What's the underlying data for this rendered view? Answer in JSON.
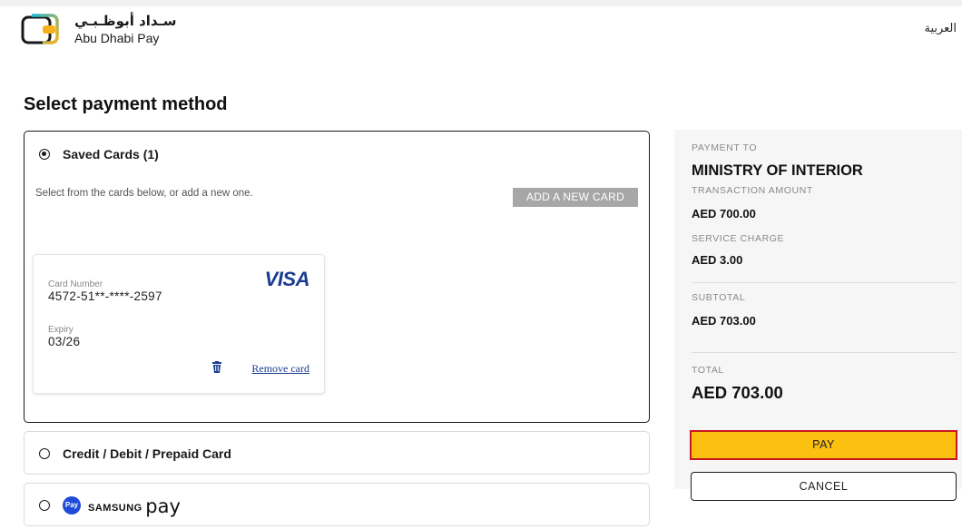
{
  "header": {
    "logo_ar": "سـداد أبوظـبـي",
    "logo_en": "Abu Dhabi Pay",
    "lang_link": "العربية"
  },
  "page_title": "Select payment method",
  "saved_cards": {
    "label": "Saved Cards (1)",
    "hint": "Select from the cards below, or add a new one.",
    "add_button": "ADD A NEW CARD",
    "card": {
      "brand": "VISA",
      "number_label": "Card Number",
      "number": "4572-51**-****-2597",
      "expiry_label": "Expiry",
      "expiry": "03/26",
      "remove_label": "Remove card"
    }
  },
  "methods": {
    "credit": "Credit / Debit / Prepaid Card",
    "samsung_badge": "Pay",
    "samsung_brand": "SAMSUNG",
    "samsung_pay": "pay"
  },
  "summary": {
    "payment_to_label": "PAYMENT TO",
    "payment_to": "MINISTRY OF INTERIOR",
    "transaction_label": "TRANSACTION AMOUNT",
    "transaction": "AED  700.00",
    "service_label": "SERVICE CHARGE",
    "service": "AED  3.00",
    "subtotal_label": "SUBTOTAL",
    "subtotal": "AED  703.00",
    "total_label": "TOTAL",
    "total": "AED 703.00"
  },
  "actions": {
    "pay": "PAY",
    "cancel": "CANCEL"
  },
  "colors": {
    "pay_bg": "#fcc010",
    "pay_border": "#c7171e",
    "link": "#1a3c8f",
    "visa": "#1a3c8f",
    "samsung": "#1f4bd8"
  }
}
